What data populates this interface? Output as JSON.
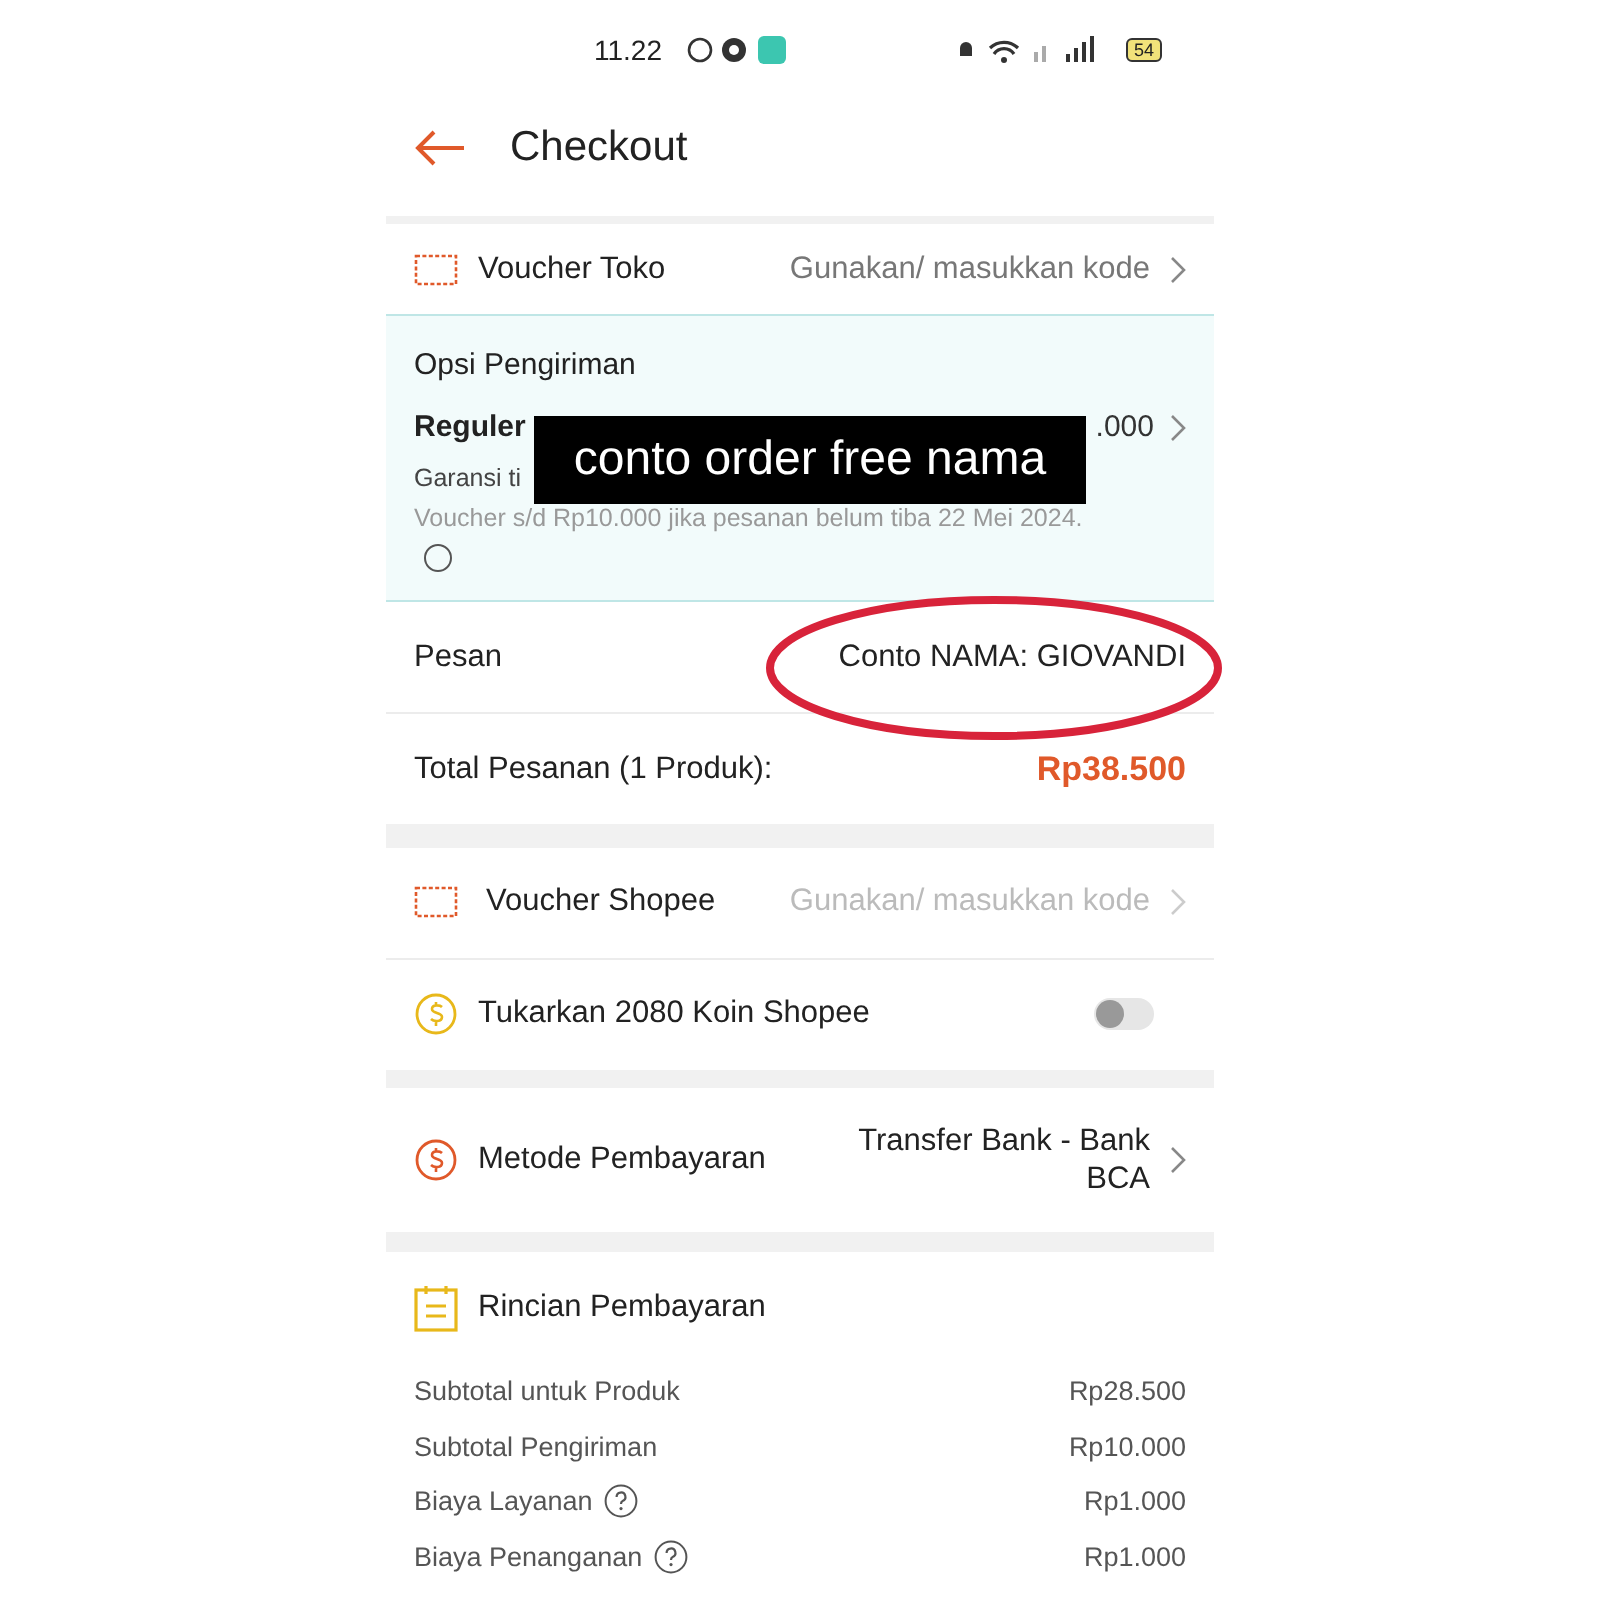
{
  "status_bar": {
    "time": "11.22",
    "battery": "54"
  },
  "header": {
    "title": "Checkout"
  },
  "voucher_toko": {
    "label": "Voucher Toko",
    "action": "Gunakan/ masukkan kode",
    "disabled": false
  },
  "shipping": {
    "title": "Opsi Pengiriman",
    "service": "Reguler",
    "price": ".000",
    "guarantee": "Garansi ti",
    "voucher_note": "Voucher s/d Rp10.000 jika pesanan belum tiba 22 Mei 2024.",
    "selected": false
  },
  "overlay_caption": "conto order free nama",
  "message": {
    "label": "Pesan",
    "value": "Conto NAMA: GIOVANDI"
  },
  "order_total": {
    "label": "Total Pesanan (1 Produk):",
    "amount": "Rp38.500"
  },
  "voucher_shopee": {
    "label": "Voucher Shopee",
    "action": "Gunakan/ masukkan kode",
    "disabled": true
  },
  "coins": {
    "label": "Tukarkan 2080 Koin Shopee",
    "on": false
  },
  "payment": {
    "label": "Metode Pembayaran",
    "value": "Transfer Bank - Bank BCA"
  },
  "details": {
    "title": "Rincian Pembayaran",
    "rows": [
      {
        "label": "Subtotal untuk Produk",
        "amount": "Rp28.500",
        "info": false
      },
      {
        "label": "Subtotal Pengiriman",
        "amount": "Rp10.000",
        "info": false
      },
      {
        "label": "Biaya Layanan",
        "amount": "Rp1.000",
        "info": true
      },
      {
        "label": "Biaya Penanganan",
        "amount": "Rp1.000",
        "info": true
      }
    ]
  }
}
